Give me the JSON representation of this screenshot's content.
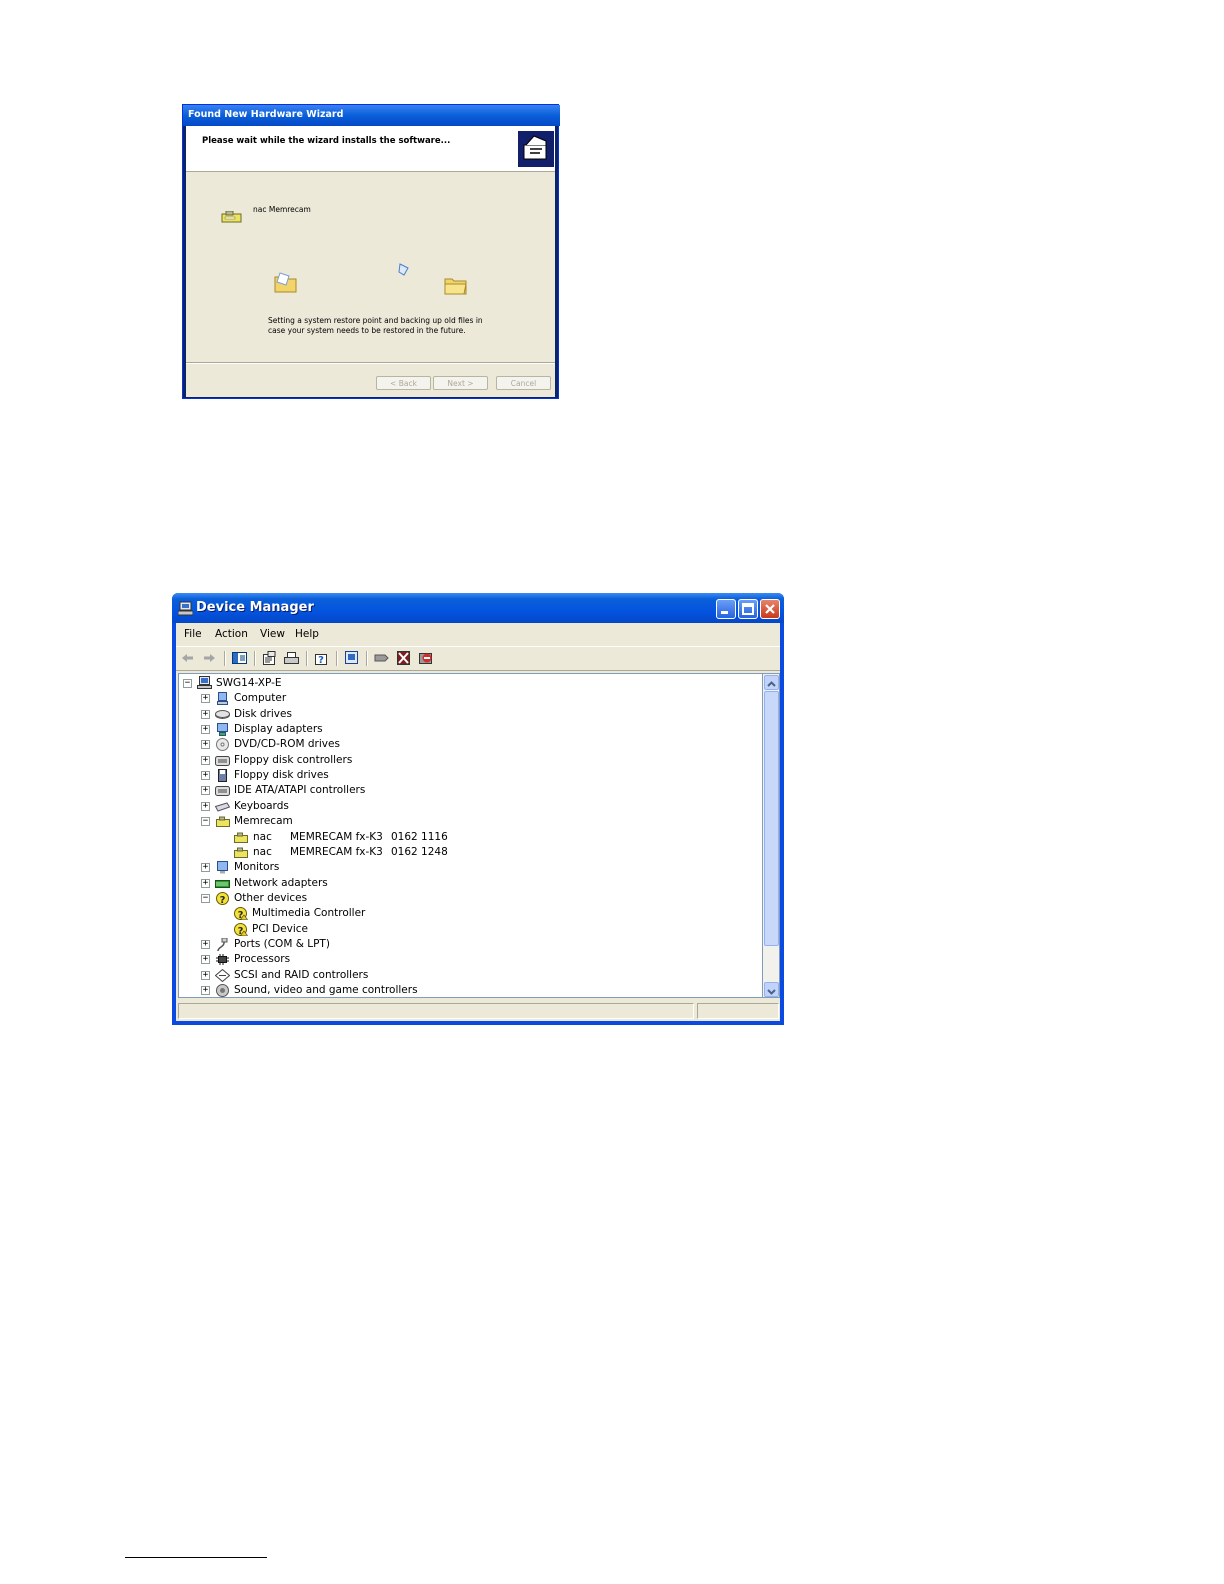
{
  "wizard": {
    "title": "Found New Hardware Wizard",
    "header": "Please wait while the wizard installs the software...",
    "device_name": "nac Memrecam",
    "status_line1": "Setting a system restore point and backing up old files in",
    "status_line2": "case your system needs to be restored in the future.",
    "buttons": {
      "back": "< Back",
      "next": "Next >",
      "cancel": "Cancel"
    }
  },
  "device_manager": {
    "title": "Device Manager",
    "menu": [
      "File",
      "Action",
      "View",
      "Help"
    ],
    "toolbar_icons": [
      "back-icon",
      "forward-icon",
      "show-hide-tree-icon",
      "properties-icon",
      "print-icon",
      "help-icon",
      "scan-hardware-icon",
      "update-driver-icon",
      "uninstall-icon",
      "disable-icon"
    ],
    "tree": {
      "root": "SWG14-XP-E",
      "items": [
        {
          "label": "Computer",
          "expanded": false,
          "icon": "computer-icon"
        },
        {
          "label": "Disk drives",
          "expanded": false,
          "icon": "disk-drive-icon"
        },
        {
          "label": "Display adapters",
          "expanded": false,
          "icon": "display-adapter-icon"
        },
        {
          "label": "DVD/CD-ROM drives",
          "expanded": false,
          "icon": "cdrom-icon"
        },
        {
          "label": "Floppy disk controllers",
          "expanded": false,
          "icon": "controller-icon"
        },
        {
          "label": "Floppy disk drives",
          "expanded": false,
          "icon": "floppy-icon"
        },
        {
          "label": "IDE ATA/ATAPI controllers",
          "expanded": false,
          "icon": "controller-icon"
        },
        {
          "label": "Keyboards",
          "expanded": false,
          "icon": "keyboard-icon"
        },
        {
          "label": "Memrecam",
          "expanded": true,
          "icon": "camera-icon",
          "children": [
            {
              "vendor": "nac",
              "model": "MEMRECAM fx-K3",
              "serial": "0162 1116"
            },
            {
              "vendor": "nac",
              "model": "MEMRECAM fx-K3",
              "serial": "0162 1248"
            }
          ]
        },
        {
          "label": "Monitors",
          "expanded": false,
          "icon": "monitor-icon"
        },
        {
          "label": "Network adapters",
          "expanded": false,
          "icon": "network-icon"
        },
        {
          "label": "Other devices",
          "expanded": true,
          "icon": "unknown-device-icon",
          "children": [
            {
              "label": "Multimedia Controller"
            },
            {
              "label": "PCI Device"
            }
          ]
        },
        {
          "label": "Ports (COM & LPT)",
          "expanded": false,
          "icon": "port-icon"
        },
        {
          "label": "Processors",
          "expanded": false,
          "icon": "processor-icon"
        },
        {
          "label": "SCSI and RAID controllers",
          "expanded": false,
          "icon": "scsi-icon"
        },
        {
          "label": "Sound, video and game controllers",
          "expanded": false,
          "icon": "sound-icon"
        }
      ]
    }
  }
}
